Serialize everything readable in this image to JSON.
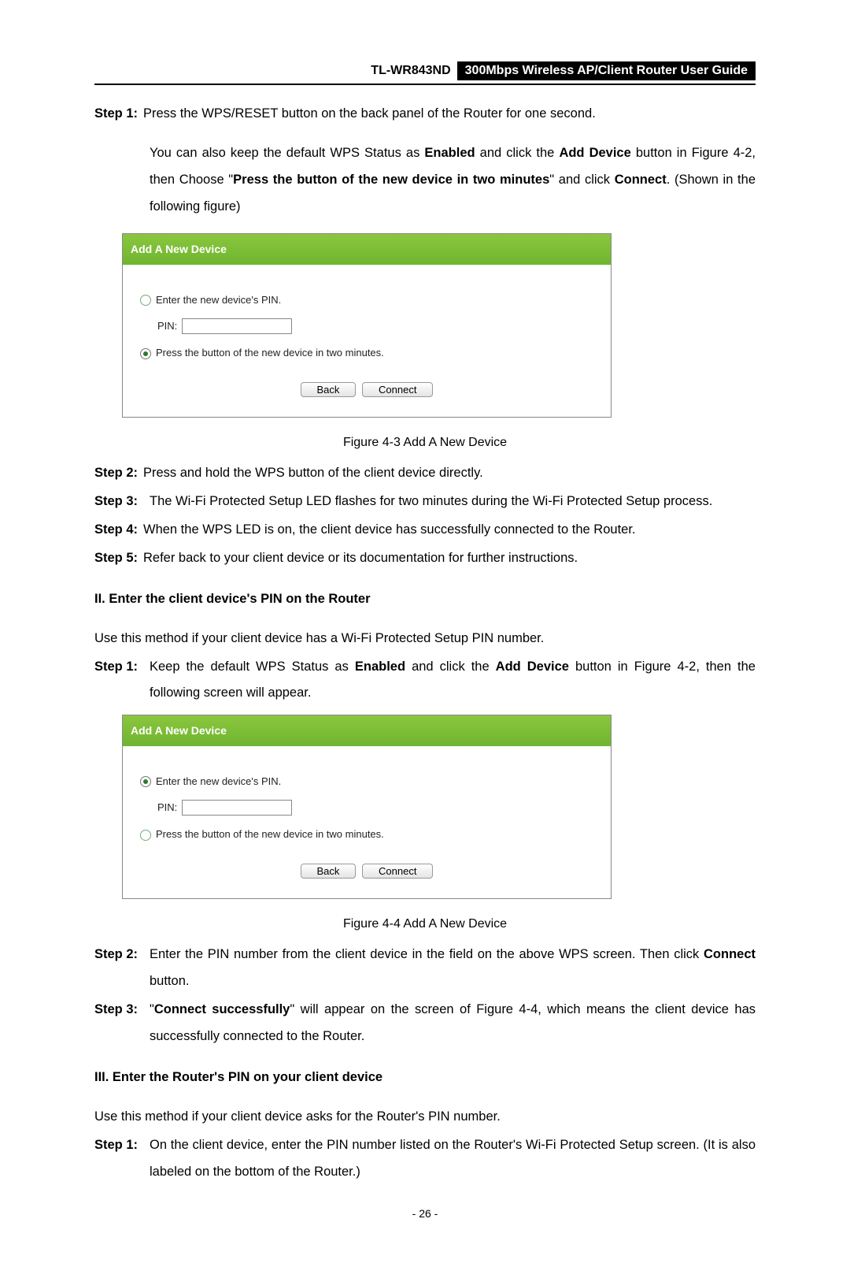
{
  "header": {
    "model": "TL-WR843ND",
    "guide": "300Mbps Wireless AP/Client Router User Guide"
  },
  "section1": {
    "step1_label": "Step 1:",
    "step1_a": "Press the WPS/RESET button on the back panel of the Router for one second.",
    "step1_b_1": "You can also keep the default WPS Status as ",
    "step1_b_bold1": "Enabled",
    "step1_b_2": " and click the ",
    "step1_b_bold2": "Add Device",
    "step1_b_3": " button in Figure 4-2, then Choose \"",
    "step1_b_bold3": "Press the button of the new device in two minutes",
    "step1_b_4": "\" and click ",
    "step1_b_bold4": "Connect",
    "step1_b_5": ". (Shown in the following figure)",
    "fig_caption": "Figure 4-3 Add A New Device",
    "step2_label": "Step 2:",
    "step2": "Press and hold the WPS button of the client device directly.",
    "step3_label": "Step 3:",
    "step3": "The Wi-Fi Protected Setup LED flashes for two minutes during the Wi-Fi Protected Setup process.",
    "step4_label": "Step 4:",
    "step4": "When the WPS LED is on, the client device has successfully connected to the Router.",
    "step5_label": "Step 5:",
    "step5": "Refer back to your client device or its documentation for further instructions."
  },
  "panel1": {
    "title": "Add A New Device",
    "opt1": "Enter the new device's PIN.",
    "pin_label": "PIN:",
    "opt2": "Press the button of the new device in two minutes.",
    "back": "Back",
    "connect": "Connect"
  },
  "section2": {
    "heading": "II.   Enter the client device's PIN on the Router",
    "intro": "Use this method if your client device has a Wi-Fi Protected Setup PIN number.",
    "step1_label": "Step 1:",
    "step1_1": "Keep the default WPS Status as ",
    "step1_bold1": "Enabled",
    "step1_2": " and click the ",
    "step1_bold2": "Add Device",
    "step1_3": " button in Figure 4-2, then the following screen will appear.",
    "fig_caption": "Figure 4-4    Add A New Device",
    "step2_label": "Step 2:",
    "step2_1": "Enter the PIN number from the client device in the field on the above WPS screen. Then click ",
    "step2_bold": "Connect",
    "step2_2": " button.",
    "step3_label": "Step 3:",
    "step3_1": "\"",
    "step3_bold": "Connect successfully",
    "step3_2": "\" will appear on the screen of Figure 4-4, which means the client device has successfully connected to the Router."
  },
  "panel2": {
    "title": "Add A New Device",
    "opt1": "Enter the new device's PIN.",
    "pin_label": "PIN:",
    "opt2": "Press the button of the new device in two minutes.",
    "back": "Back",
    "connect": "Connect"
  },
  "section3": {
    "heading": "III.  Enter the Router's PIN on your client device",
    "intro": "Use this method if your client device asks for the Router's PIN number.",
    "step1_label": "Step 1:",
    "step1": "On the client device, enter the PIN number listed on the Router's Wi-Fi Protected Setup screen. (It is also labeled on the bottom of the Router.)"
  },
  "page_num": "- 26 -"
}
